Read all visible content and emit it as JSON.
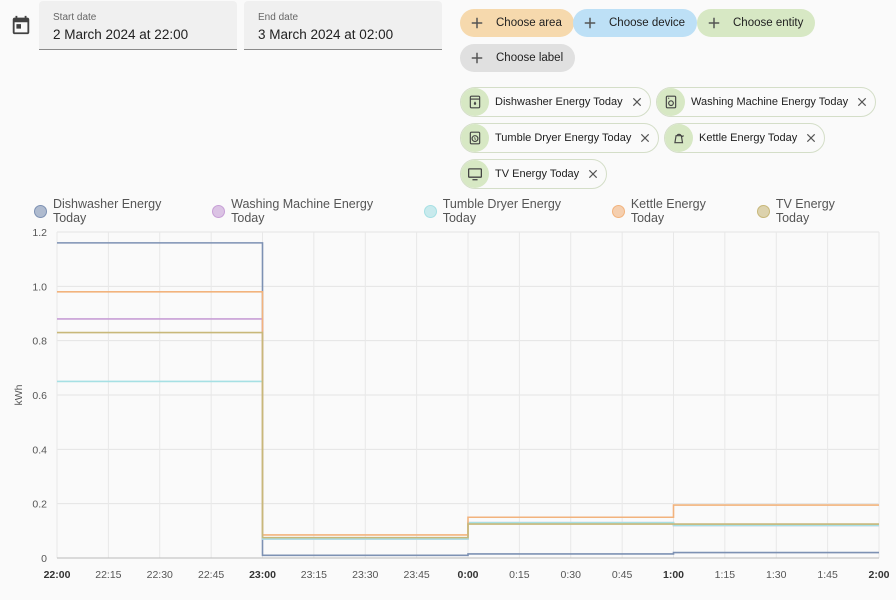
{
  "date_range": {
    "start_label": "Start date",
    "start_value": "2 March 2024 at 22:00",
    "end_label": "End date",
    "end_value": "3 March 2024 at 02:00"
  },
  "target_pickers": {
    "area": "Choose area",
    "device": "Choose device",
    "entity": "Choose entity",
    "label": "Choose label"
  },
  "selected_entities": [
    {
      "name": "Dishwasher Energy Today",
      "icon": "dishwasher-icon"
    },
    {
      "name": "Washing Machine Energy Today",
      "icon": "washing-machine-icon"
    },
    {
      "name": "Tumble Dryer Energy Today",
      "icon": "tumble-dryer-icon"
    },
    {
      "name": "Kettle Energy Today",
      "icon": "kettle-icon"
    },
    {
      "name": "TV Energy Today",
      "icon": "tv-icon"
    }
  ],
  "colors": {
    "area": "#f6d9ad",
    "device": "#bde0f6",
    "entity": "#d7e8c4",
    "label": "#e0e0e0"
  },
  "chart_data": {
    "type": "line",
    "step": true,
    "ylabel": "kWh",
    "ylim": [
      0,
      1.2
    ],
    "yticks": [
      "0",
      "0.2",
      "0.4",
      "0.6",
      "0.8",
      "1.0",
      "1.2"
    ],
    "x_ticks": [
      {
        "label": "22:00",
        "bold": true
      },
      {
        "label": "22:15",
        "bold": false
      },
      {
        "label": "22:30",
        "bold": false
      },
      {
        "label": "22:45",
        "bold": false
      },
      {
        "label": "23:00",
        "bold": true
      },
      {
        "label": "23:15",
        "bold": false
      },
      {
        "label": "23:30",
        "bold": false
      },
      {
        "label": "23:45",
        "bold": false
      },
      {
        "label": "0:00",
        "bold": true
      },
      {
        "label": "0:15",
        "bold": false
      },
      {
        "label": "0:30",
        "bold": false
      },
      {
        "label": "0:45",
        "bold": false
      },
      {
        "label": "1:00",
        "bold": true
      },
      {
        "label": "1:15",
        "bold": false
      },
      {
        "label": "1:30",
        "bold": false
      },
      {
        "label": "1:45",
        "bold": false
      },
      {
        "label": "2:00",
        "bold": true
      }
    ],
    "x": [
      "22:00",
      "23:00",
      "0:00",
      "1:00",
      "2:00"
    ],
    "grid": true,
    "legend_position": "top",
    "series": [
      {
        "name": "Dishwasher Energy Today",
        "color": "#7d91b3",
        "values": [
          1.16,
          0.01,
          0.015,
          0.02
        ]
      },
      {
        "name": "Washing Machine Energy Today",
        "color": "#c79fd6",
        "values": [
          0.88,
          0.07,
          0.13,
          0.12
        ]
      },
      {
        "name": "Tumble Dryer Energy Today",
        "color": "#a6e0e4",
        "values": [
          0.65,
          0.07,
          0.13,
          0.12
        ]
      },
      {
        "name": "Kettle Energy Today",
        "color": "#f2b37d",
        "values": [
          0.98,
          0.085,
          0.15,
          0.195
        ]
      },
      {
        "name": "TV Energy Today",
        "color": "#c8b87a",
        "values": [
          0.83,
          0.075,
          0.125,
          0.125
        ]
      }
    ]
  }
}
